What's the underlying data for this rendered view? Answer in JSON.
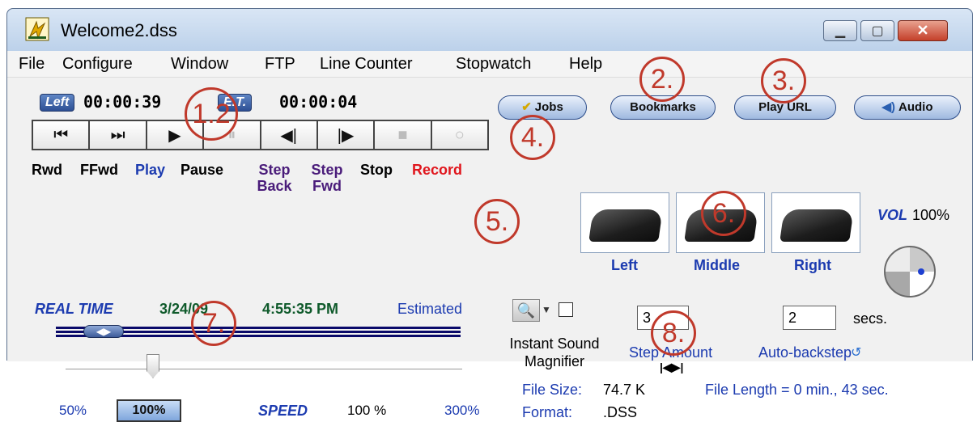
{
  "window": {
    "title": "Welcome2.dss",
    "controls": {
      "minimize": "▁",
      "maximize": "▢",
      "close": "✕"
    }
  },
  "menu": [
    "File",
    "Configure",
    "Window",
    "FTP",
    "Line Counter",
    "Stopwatch",
    "Help"
  ],
  "timers": {
    "left_label": "Left",
    "left_time": "00:00:39",
    "et_label": "E.T.",
    "et_time": "00:00:04"
  },
  "transport": {
    "rwd": "⏮",
    "ffwd": "⏭",
    "play": "▶",
    "pause": "⏸",
    "step_back": "◀|",
    "step_fwd": "|▶",
    "stop": "■",
    "record": "○",
    "labels": {
      "rwd": "Rwd",
      "ffwd": "FFwd",
      "play": "Play",
      "pause": "Pause",
      "step_back": "Step Back",
      "step_fwd": "Step Fwd",
      "stop": "Stop",
      "record": "Record"
    }
  },
  "buttons": {
    "jobs": "Jobs",
    "bookmarks": "Bookmarks",
    "play_url": "Play URL",
    "audio": "Audio"
  },
  "pedals": {
    "left": "Left",
    "middle": "Middle",
    "right": "Right"
  },
  "volume": {
    "label": "VOL",
    "value": "100%",
    "level": 1.0
  },
  "realtime": {
    "label": "REAL TIME",
    "date": "3/24/09",
    "time": "4:55:35 PM",
    "estimated": "Estimated"
  },
  "magnifier": {
    "label": "Instant Sound Magnifier",
    "checked": false
  },
  "step": {
    "amount": "3",
    "label": "Step Amount",
    "arrows": "|◀▶|"
  },
  "backstep": {
    "amount": "2",
    "secs": "secs.",
    "label": "Auto-backstep"
  },
  "file_info": {
    "size_label": "File Size:",
    "size_value": "74.7 K",
    "length_label": "File Length = 0 min., 43 sec.",
    "format_label": "Format:",
    "format_value": ".DSS"
  },
  "speed": {
    "min": "50%",
    "current_btn": "100%",
    "label": "SPEED",
    "value": "100 %",
    "max": "300%",
    "current_percent": 100
  },
  "callouts": [
    "1.",
    "2.",
    "3.",
    "4.",
    "5.",
    "6.",
    "7.",
    "8."
  ],
  "callout_12": "1.2"
}
